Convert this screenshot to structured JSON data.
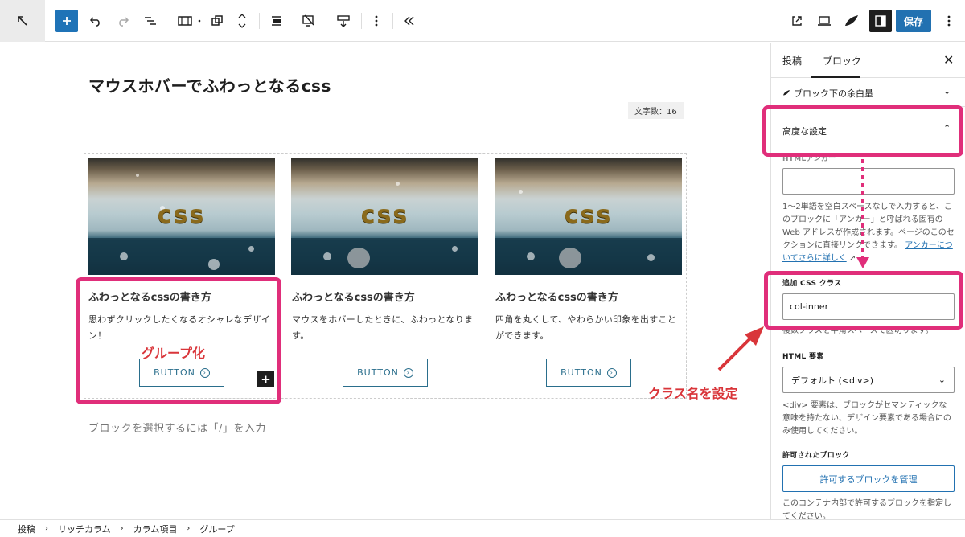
{
  "toolbar": {
    "save_label": "保存"
  },
  "editor": {
    "post_title": "マウスホバーでふわっとなるcss",
    "char_count": "文字数：16",
    "columns": [
      {
        "image_text": "css",
        "title": "ふわっとなるcssの書き方",
        "desc": "思わずクリックしたくなるオシャレなデザイン！",
        "button": "BUTTON"
      },
      {
        "image_text": "css",
        "title": "ふわっとなるcssの書き方",
        "desc": "マウスをホバーしたときに、ふわっとなります。",
        "button": "BUTTON"
      },
      {
        "image_text": "css",
        "title": "ふわっとなるcssの書き方",
        "desc": "四角を丸くして、やわらかい印象を出すことができます。",
        "button": "BUTTON"
      }
    ],
    "placeholder": "ブロックを選択するには「/」を入力"
  },
  "annotations": {
    "group_label": "グループ化",
    "class_label": "クラス名を設定",
    "highlight_color": "#e02e7a",
    "text_color": "#d9353a"
  },
  "sidebar": {
    "tabs": [
      "投稿",
      "ブロック"
    ],
    "active_tab": "ブロック",
    "close_icon": "close-icon",
    "spacing_row": "ブロック下の余白量",
    "advanced_row": "高度な設定",
    "html_anchor_label": "HTMLアンカー",
    "html_anchor_value": "",
    "anchor_help": "1〜2単語を空白スペースなしで入力すると、このブロックに「アンカー」と呼ばれる固有の Web アドレスが作成されます。ページのこのセクションに直接リンクできます。",
    "anchor_help_link": "アンカーについてさらに詳しく",
    "css_class_label": "追加 CSS クラス",
    "css_class_value": "col-inner",
    "css_class_help": "複数クラスを半角スペースで区切ります。",
    "html_element_label": "HTML 要素",
    "html_element_value": "デフォルト (<div>)",
    "html_element_help": "<div> 要素は、ブロックがセマンティックな意味を持たない、デザイン要素である場合にのみ使用してください。",
    "allowed_blocks_label": "許可されたブロック",
    "manage_blocks_button": "許可するブロックを管理",
    "allowed_blocks_help": "このコンテナ内部で許可するブロックを指定してください。"
  },
  "breadcrumb": [
    "投稿",
    "リッチカラム",
    "カラム項目",
    "グループ"
  ]
}
